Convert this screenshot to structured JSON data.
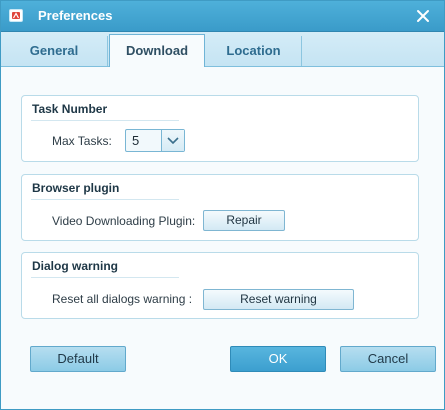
{
  "window": {
    "title": "Preferences"
  },
  "tabs": [
    {
      "label": "General"
    },
    {
      "label": "Download",
      "active": true
    },
    {
      "label": "Location"
    }
  ],
  "task_number": {
    "title": "Task Number",
    "max_tasks_label": "Max Tasks:",
    "max_tasks_value": "5"
  },
  "browser_plugin": {
    "title": "Browser plugin",
    "plugin_label": "Video Downloading Plugin:",
    "repair_label": "Repair"
  },
  "dialog_warning": {
    "title": "Dialog warning",
    "reset_label": "Reset all dialogs warning :",
    "reset_button_label": "Reset warning"
  },
  "footer": {
    "default_label": "Default",
    "ok_label": "OK",
    "cancel_label": "Cancel"
  },
  "colors": {
    "accent": "#3a9bc9",
    "panel_border": "#b9dbe9",
    "ok_button": "#3c9fcf"
  },
  "icons": {
    "app": "app-icon",
    "close": "close-icon",
    "dropdown": "chevron-down-icon"
  }
}
